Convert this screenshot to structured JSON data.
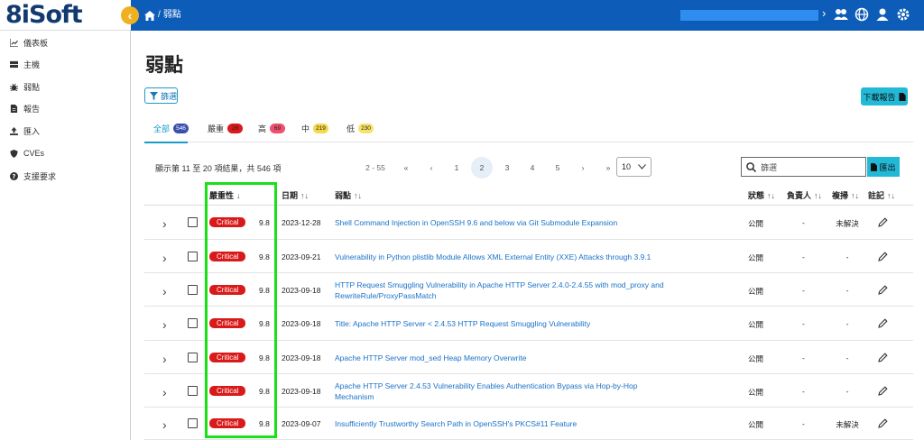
{
  "brand": {
    "logo_text": "8iSoft",
    "collapse_glyph": "‹"
  },
  "breadcrumb": {
    "home_icon": "home-icon",
    "separator": "/",
    "current": "弱點"
  },
  "header_icons": [
    "users-icon",
    "globe-icon",
    "user-icon",
    "gear-icon"
  ],
  "sidebar": {
    "items": [
      {
        "label": "儀表板",
        "icon": "chart-icon"
      },
      {
        "label": "主機",
        "icon": "server-icon"
      },
      {
        "label": "弱點",
        "icon": "bug-icon"
      },
      {
        "label": "報告",
        "icon": "file-icon"
      },
      {
        "label": "匯入",
        "icon": "upload-icon"
      },
      {
        "label": "CVEs",
        "icon": "shield-icon"
      },
      {
        "label": "支援要求",
        "icon": "question-icon"
      }
    ]
  },
  "page": {
    "title": "弱點",
    "filter_label": "篩選",
    "download_label": "下載報告"
  },
  "tabs": [
    {
      "label": "全部",
      "count": "546",
      "color": "#3b4fb0"
    },
    {
      "label": "嚴重",
      "count": "28",
      "color": "#d91a1a"
    },
    {
      "label": "高",
      "count": "69",
      "color": "#f0506e"
    },
    {
      "label": "中",
      "count": "219",
      "color": "#f5d94a"
    },
    {
      "label": "低",
      "count": "230",
      "color": "#f7e36a"
    }
  ],
  "toolbar": {
    "result_text": "顯示第 11 至 20 項結果，共 546 項",
    "page_range": "2 - 55",
    "first": "«",
    "prev": "‹",
    "pages": [
      "1",
      "2",
      "3",
      "4",
      "5"
    ],
    "current_page": "2",
    "next": "›",
    "last": "»",
    "per_page": "10",
    "search_placeholder": "篩選",
    "export_label": "匯出"
  },
  "table": {
    "headers": {
      "severity": "嚴重性",
      "date": "日期",
      "vuln": "弱點",
      "status": "狀態",
      "owner": "負責人",
      "fix": "複掃",
      "note": "註記"
    },
    "rows": [
      {
        "severity": "Critical",
        "score": "9.8",
        "date": "2023-12-28",
        "title": "Shell Command Injection in OpenSSH 9.6 and below via Git Submodule Expansion",
        "status": "公開",
        "owner": "-",
        "fix": "未解決"
      },
      {
        "severity": "Critical",
        "score": "9.8",
        "date": "2023-09-21",
        "title": "Vulnerability in Python plistlib Module Allows XML External Entity (XXE) Attacks through 3.9.1",
        "status": "公開",
        "owner": "-",
        "fix": "-"
      },
      {
        "severity": "Critical",
        "score": "9.8",
        "date": "2023-09-18",
        "title": "HTTP Request Smuggling Vulnerability in Apache HTTP Server 2.4.0-2.4.55 with mod_proxy and RewriteRule/ProxyPassMatch",
        "status": "公開",
        "owner": "-",
        "fix": "-"
      },
      {
        "severity": "Critical",
        "score": "9.8",
        "date": "2023-09-18",
        "title": "Title: Apache HTTP Server < 2.4.53 HTTP Request Smuggling Vulnerability",
        "status": "公開",
        "owner": "-",
        "fix": "-"
      },
      {
        "severity": "Critical",
        "score": "9.8",
        "date": "2023-09-18",
        "title": "Apache HTTP Server mod_sed Heap Memory Overwrite",
        "status": "公開",
        "owner": "-",
        "fix": "-"
      },
      {
        "severity": "Critical",
        "score": "9.8",
        "date": "2023-09-18",
        "title": "Apache HTTP Server 2.4.53 Vulnerability Enables Authentication Bypass via Hop-by-Hop Mechanism",
        "status": "公開",
        "owner": "-",
        "fix": "-"
      },
      {
        "severity": "Critical",
        "score": "9.8",
        "date": "2023-09-07",
        "title": "Insufficiently Trustworthy Search Path in OpenSSH's PKCS#11 Feature",
        "status": "公開",
        "owner": "-",
        "fix": "未解決"
      }
    ]
  },
  "colors": {
    "header_blue": "#0d5db8",
    "accent": "#1a9bc8",
    "critical": "#d91a1a",
    "highlight": "#19e019"
  }
}
